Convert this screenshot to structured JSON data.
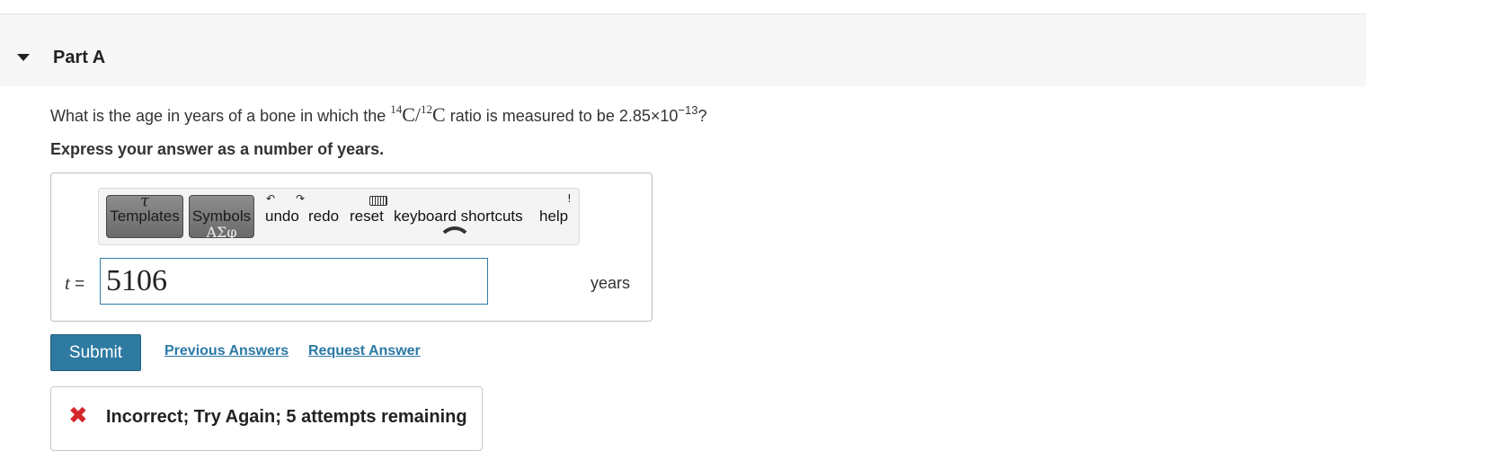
{
  "part": {
    "title": "Part A"
  },
  "question": {
    "prefix": "What is the age in years of a bone in which the",
    "iso_a_mass": "14",
    "iso_a_sym": "C/",
    "iso_b_mass": "12",
    "iso_b_sym": "C",
    "middle": "ratio is measured to be",
    "ratio_base": "2.85×10",
    "ratio_exp": "−13",
    "suffix": "?"
  },
  "instruction": "Express your answer as a number of years.",
  "toolbar": {
    "templates_label": "Templates",
    "templates_glyph": "τ",
    "symbols_label": "Symbols",
    "symbols_glyph": "ΑΣφ",
    "undo_label": "undo",
    "redo_label": "redo",
    "reset_label": "reset",
    "shortcuts_label": "keyboard shortcuts",
    "help_label": "help"
  },
  "answer": {
    "variable": "t",
    "equals": "=",
    "value": "5106",
    "units": "years"
  },
  "actions": {
    "submit_label": "Submit",
    "previous_answers_label": "Previous Answers",
    "request_answer_label": "Request Answer"
  },
  "feedback": {
    "icon": "x-mark-icon",
    "text": "Incorrect; Try Again; 5 attempts remaining",
    "color": "#d3262b"
  },
  "colors": {
    "accent": "#2e7aa1",
    "link": "#2a79a6",
    "error": "#d3262b"
  }
}
